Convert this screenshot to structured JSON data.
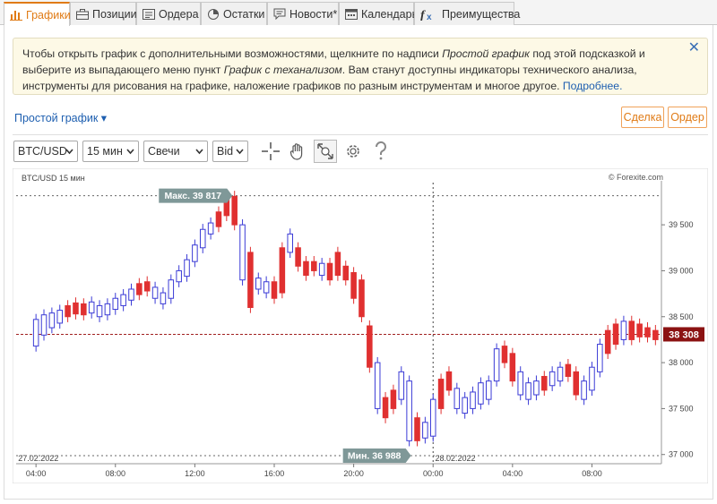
{
  "tabs": [
    {
      "label": "Графики",
      "icon": "bar-chart-icon",
      "active": true
    },
    {
      "label": "Позиции",
      "icon": "briefcase-icon",
      "active": false
    },
    {
      "label": "Ордера",
      "icon": "orders-icon",
      "active": false
    },
    {
      "label": "Остатки",
      "icon": "balance-icon",
      "active": false
    },
    {
      "label": "Новости*",
      "icon": "news-icon",
      "active": false
    },
    {
      "label": "Календарь",
      "icon": "calendar-icon",
      "active": false
    },
    {
      "label": "Преимущества",
      "icon": "fx-icon",
      "active": false
    }
  ],
  "hint": {
    "t1": "Чтобы открыть график с дополнительными возможностями, щелкните по надписи ",
    "t2": "Простой график",
    "t3": " под этой подсказкой и выберите из выпадающего меню пункт ",
    "t4": "График с теханализом",
    "t5": ". Вам станут доступны индикаторы технического анализа, инструменты для рисования на графике, наложение графиков по разным инструментам и многое другое. ",
    "link": "Подробнее.",
    "close": "✕"
  },
  "simple_chart": "Простой график ▾",
  "buttons": {
    "deal": "Сделка",
    "order": "Ордер"
  },
  "toolbar": {
    "symbol": "BTC/USD",
    "interval": "15 мин",
    "chart_type": "Свечи",
    "price": "Bid"
  },
  "accent": "#e07b16",
  "chart_data": {
    "type": "candlestick",
    "title": "BTC/USD 15 мин",
    "watermark": "© Forexite.com",
    "ylim": [
      36900,
      39920
    ],
    "yticks": [
      37000,
      37500,
      38000,
      38500,
      39000,
      39500
    ],
    "ytick_labels": [
      "37 000",
      "37 500",
      "38 000",
      "38 500",
      "39 000",
      "39 500"
    ],
    "xtick_labels": [
      "04:00",
      "08:00",
      "12:00",
      "16:00",
      "20:00",
      "00:00",
      "04:00",
      "08:00"
    ],
    "xtick_hours": [
      4,
      8,
      12,
      16,
      20,
      24,
      28,
      32
    ],
    "x_range_hours": [
      3.0,
      35.5
    ],
    "date_labels": [
      {
        "text": "27.02.2022",
        "hour": 3.1
      },
      {
        "text": "28.02.2022",
        "hour": 24.1
      }
    ],
    "day_divider_hour": 24,
    "max_label": "Макс. 39 817",
    "max_value": 39817,
    "min_label": "Мин. 36 988",
    "min_value": 36988,
    "last_label": "38 308",
    "last_value": 38308,
    "up_color": "#3b3bd6",
    "down_color": "#e03030",
    "candles": [
      [
        4.0,
        38180,
        38470
      ],
      [
        4.4,
        38300,
        38520
      ],
      [
        4.8,
        38380,
        38540
      ],
      [
        5.2,
        38430,
        38570
      ],
      [
        5.6,
        38500,
        38620
      ],
      [
        6.0,
        38530,
        38650
      ],
      [
        6.4,
        38520,
        38640
      ],
      [
        6.8,
        38540,
        38660
      ],
      [
        7.2,
        38500,
        38620
      ],
      [
        7.6,
        38520,
        38640
      ],
      [
        8.0,
        38580,
        38700
      ],
      [
        8.4,
        38620,
        38740
      ],
      [
        8.8,
        38680,
        38800
      ],
      [
        9.2,
        38740,
        38860
      ],
      [
        9.6,
        38780,
        38880
      ],
      [
        10.0,
        38700,
        38820
      ],
      [
        10.4,
        38640,
        38760
      ],
      [
        10.8,
        38700,
        38900
      ],
      [
        11.2,
        38880,
        39000
      ],
      [
        11.6,
        38940,
        39120
      ],
      [
        12.0,
        39100,
        39280
      ],
      [
        12.4,
        39250,
        39450
      ],
      [
        12.8,
        39400,
        39520
      ],
      [
        13.2,
        39480,
        39640
      ],
      [
        13.6,
        39600,
        39810
      ],
      [
        14.0,
        39500,
        39810
      ],
      [
        14.4,
        38900,
        39500
      ],
      [
        14.8,
        38600,
        39200
      ],
      [
        15.2,
        38800,
        38920
      ],
      [
        15.6,
        38760,
        38880
      ],
      [
        16.0,
        38700,
        38880
      ],
      [
        16.4,
        38760,
        39250
      ],
      [
        16.8,
        39200,
        39400
      ],
      [
        17.2,
        39050,
        39250
      ],
      [
        17.6,
        38950,
        39100
      ],
      [
        18.0,
        39000,
        39100
      ],
      [
        18.4,
        38950,
        39080
      ],
      [
        18.8,
        38900,
        39080
      ],
      [
        19.2,
        38950,
        39200
      ],
      [
        19.6,
        38900,
        39050
      ],
      [
        20.0,
        38700,
        38980
      ],
      [
        20.4,
        38500,
        38900
      ],
      [
        20.8,
        37950,
        38400
      ],
      [
        21.2,
        37500,
        38000
      ],
      [
        21.6,
        37400,
        37620
      ],
      [
        22.0,
        37500,
        37700
      ],
      [
        22.4,
        37600,
        37900
      ],
      [
        22.8,
        37150,
        37800
      ],
      [
        23.2,
        37150,
        37400
      ],
      [
        23.6,
        37180,
        37350
      ],
      [
        24.0,
        37200,
        37600
      ],
      [
        24.4,
        37500,
        37820
      ],
      [
        24.8,
        37700,
        37900
      ],
      [
        25.2,
        37500,
        37720
      ],
      [
        25.6,
        37450,
        37620
      ],
      [
        26.0,
        37500,
        37680
      ],
      [
        26.4,
        37550,
        37780
      ],
      [
        26.8,
        37600,
        37800
      ],
      [
        27.2,
        37800,
        38150
      ],
      [
        27.6,
        38000,
        38180
      ],
      [
        28.0,
        37800,
        38100
      ],
      [
        28.4,
        37650,
        37900
      ],
      [
        28.8,
        37600,
        37780
      ],
      [
        29.2,
        37650,
        37800
      ],
      [
        29.6,
        37700,
        37850
      ],
      [
        30.0,
        37750,
        37900
      ],
      [
        30.4,
        37800,
        37950
      ],
      [
        30.8,
        37850,
        37980
      ],
      [
        31.2,
        37650,
        37900
      ],
      [
        31.6,
        37600,
        37800
      ],
      [
        32.0,
        37700,
        37950
      ],
      [
        32.4,
        37900,
        38200
      ],
      [
        32.8,
        38100,
        38350
      ],
      [
        33.2,
        38200,
        38420
      ],
      [
        33.6,
        38250,
        38450
      ],
      [
        34.0,
        38250,
        38450
      ],
      [
        34.4,
        38280,
        38420
      ],
      [
        34.8,
        38280,
        38380
      ],
      [
        35.2,
        38250,
        38350
      ]
    ],
    "candle_directions": "uuuuddduuuuuudduuuuuuuuddduduudduddduddddddudduuduudduuuuuudduuuduudduuuddudd"
  }
}
